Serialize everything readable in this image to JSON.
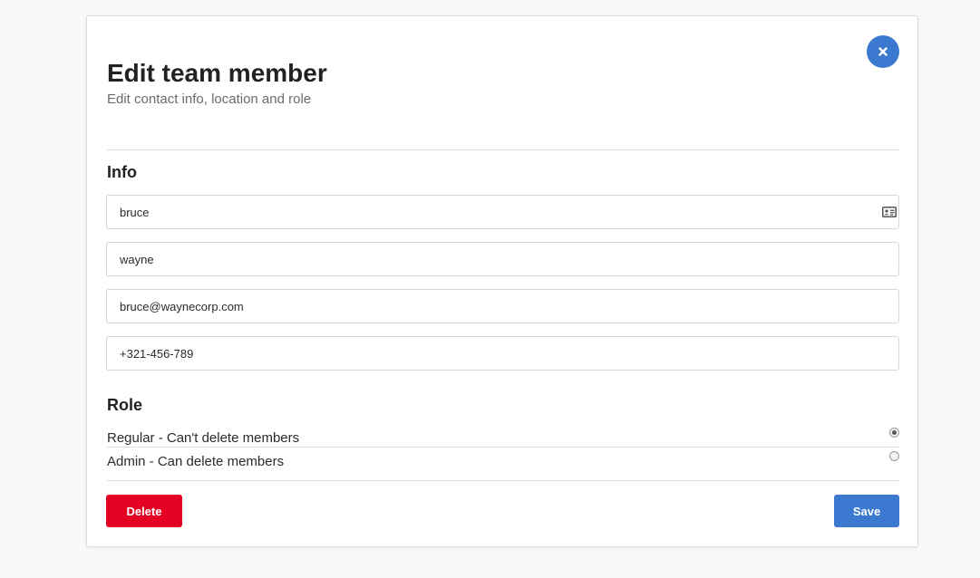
{
  "modal": {
    "title": "Edit team member",
    "subtitle": "Edit contact info, location and role",
    "close_icon": "close-icon"
  },
  "info": {
    "heading": "Info",
    "first_name": "bruce",
    "last_name": "wayne",
    "email": "bruce@waynecorp.com",
    "phone": "+321-456-789",
    "contact_card_icon": "contact-card-icon"
  },
  "role": {
    "heading": "Role",
    "options": [
      {
        "label": "Regular - Can't delete members",
        "selected": true
      },
      {
        "label": "Admin - Can delete members",
        "selected": false
      }
    ]
  },
  "actions": {
    "delete_label": "Delete",
    "save_label": "Save"
  },
  "colors": {
    "primary": "#3b78d0",
    "danger": "#e30022",
    "background": "#faf9f7"
  }
}
